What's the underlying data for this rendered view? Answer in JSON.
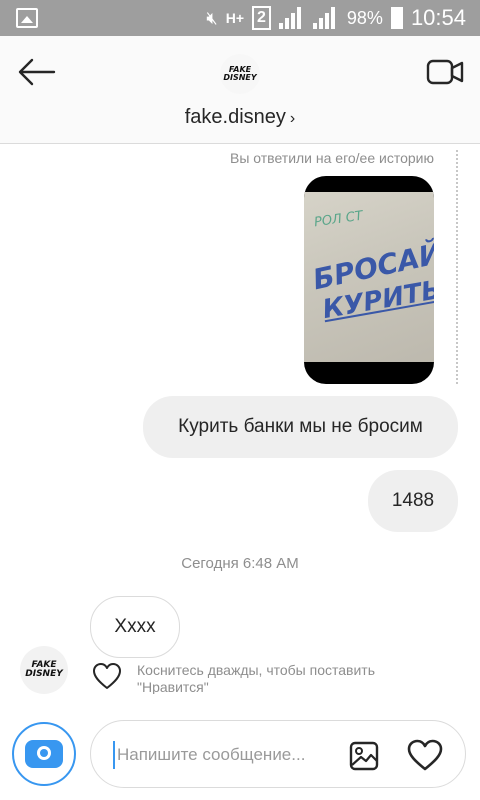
{
  "status_bar": {
    "battery": "98%",
    "time": "10:54",
    "network": "H+",
    "sim": "2"
  },
  "header": {
    "username": "fake.disney",
    "chevron": "›",
    "logo_text_line1": "FAKE",
    "logo_text_line2": "DISNEY"
  },
  "conversation": {
    "reply_note": "Вы ответили на его/ее историю",
    "story_graffiti_line1": "БРОСАЙ",
    "story_graffiti_line2": "КУРИТЬ!",
    "story_graffiti_top": "РОЛ СТ",
    "messages_out": [
      "Курить банки мы не бросим",
      "1488"
    ],
    "timestamp": "Сегодня 6:48 AM",
    "message_in": "Хххх",
    "like_hint": "Коснитесь дважды, чтобы поставить \"Нравится\""
  },
  "composer": {
    "placeholder": "Напишите сообщение..."
  },
  "icons": {
    "back": "back-arrow-icon",
    "video": "video-call-icon",
    "camera": "camera-icon",
    "gallery": "gallery-icon",
    "heart": "heart-icon"
  },
  "colors": {
    "accent": "#3897f0",
    "bubble": "#efefef",
    "status_bar": "#9e9e9e"
  }
}
